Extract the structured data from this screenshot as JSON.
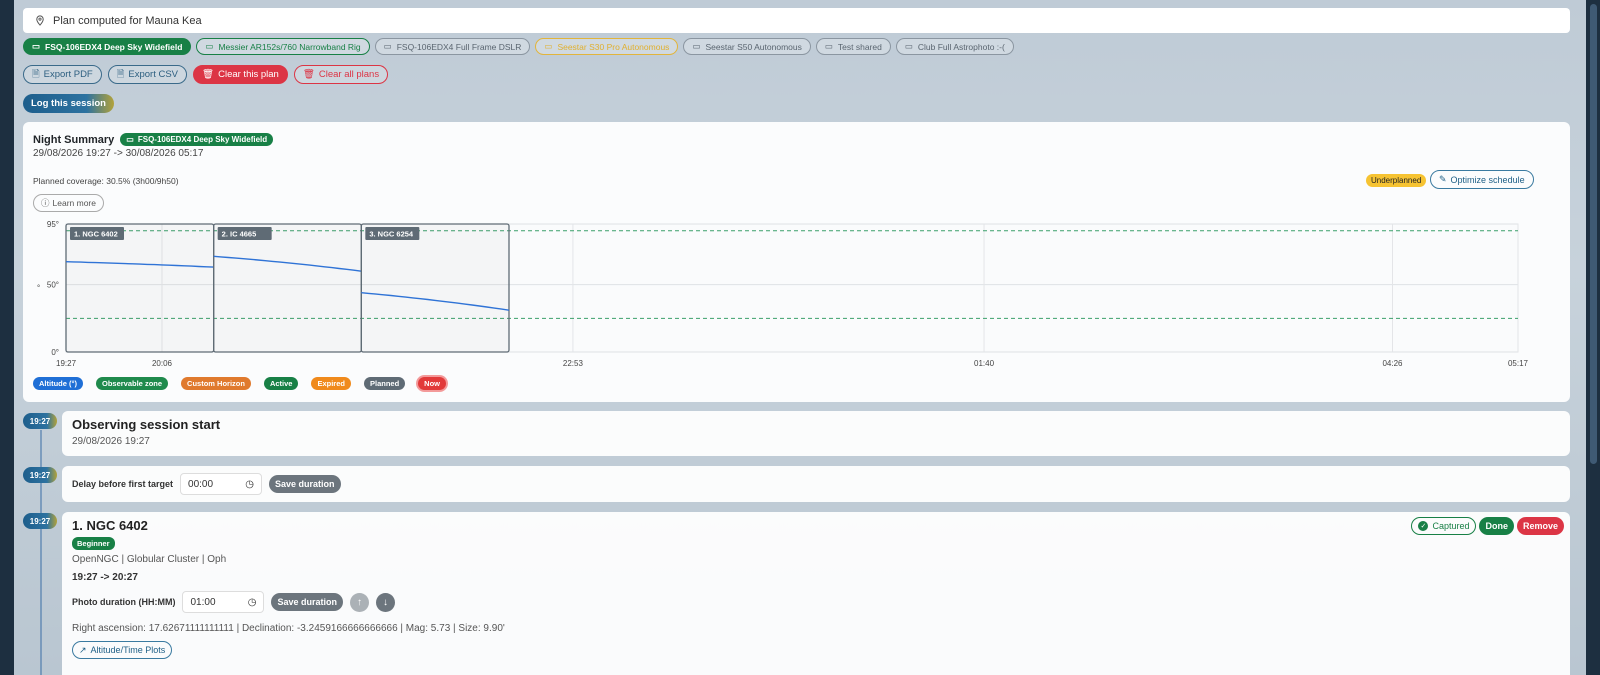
{
  "location": {
    "text": "Plan computed for Mauna Kea",
    "icon": "map-pin-icon"
  },
  "rigs": [
    {
      "label": "FSQ-106EDX4 Deep Sky Widefield",
      "state": "active"
    },
    {
      "label": "Messier AR152s/760 Narrowband Rig",
      "state": "green"
    },
    {
      "label": "FSQ-106EDX4 Full Frame DSLR",
      "state": "normal"
    },
    {
      "label": "Seestar S30 Pro Autonomous",
      "state": "yellow"
    },
    {
      "label": "Seestar S50 Autonomous",
      "state": "normal"
    },
    {
      "label": "Test shared",
      "state": "normal"
    },
    {
      "label": "Club Full Astrophoto :-(",
      "state": "normal"
    }
  ],
  "actions": {
    "export_pdf": "Export PDF",
    "export_csv": "Export CSV",
    "clear_plan": "Clear this plan",
    "clear_all": "Clear all plans",
    "log_session": "Log this session"
  },
  "summary": {
    "title": "Night Summary",
    "rig": "FSQ-106EDX4 Deep Sky Widefield",
    "dates": "29/08/2026 19:27 -> 30/08/2026 05:17",
    "coverage": "Planned coverage: 30.5% (3h00/9h50)",
    "learn_more": "Learn more",
    "status": "Underplanned",
    "optimize": "Optimize schedule"
  },
  "chart_data": {
    "type": "line",
    "ylim": [
      0,
      95
    ],
    "y_ticks": [
      "95°",
      "50°",
      "0°"
    ],
    "ylabel": "°",
    "x_range_hours": [
      0,
      9.833
    ],
    "x_ticks": [
      {
        "label": "19:27",
        "t": 0
      },
      {
        "label": "20:06",
        "t": 0.65
      },
      {
        "label": "22:53",
        "t": 3.433
      },
      {
        "label": "01:40",
        "t": 6.217
      },
      {
        "label": "04:26",
        "t": 8.983
      },
      {
        "label": "05:17",
        "t": 9.833
      }
    ],
    "observable_zone": [
      25,
      90
    ],
    "targets": [
      {
        "label": "1. NGC 6402",
        "start": 0,
        "end": 1,
        "alt": [
          67,
          63
        ]
      },
      {
        "label": "2. IC 4665",
        "start": 1,
        "end": 2,
        "alt": [
          71,
          60
        ]
      },
      {
        "label": "3. NGC 6254",
        "start": 2,
        "end": 3,
        "alt": [
          44,
          31
        ]
      }
    ],
    "legend": [
      {
        "label": "Altitude (°)",
        "color": "#1f6fd6"
      },
      {
        "label": "Observable zone",
        "color": "#1f8a4c"
      },
      {
        "label": "Custom Horizon",
        "color": "#e07a2e"
      },
      {
        "label": "Active",
        "color": "#188046"
      },
      {
        "label": "Expired",
        "color": "#f08a1c"
      },
      {
        "label": "Planned",
        "color": "#5f6b75"
      },
      {
        "label": "Now",
        "color": "#e23a3a"
      }
    ]
  },
  "session_start": {
    "time": "19:27",
    "title": "Observing session start",
    "date": "29/08/2026 19:27"
  },
  "delay": {
    "time": "19:27",
    "label": "Delay before first target",
    "value": "00:00",
    "save": "Save duration"
  },
  "target1": {
    "time": "19:27",
    "title": "1. NGC 6402",
    "level": "Beginner",
    "catalog": "OpenNGC | Globular Cluster | Oph",
    "window": "19:27 -> 20:27",
    "photo_label": "Photo duration (HH:MM)",
    "photo_value": "01:00",
    "save": "Save duration",
    "coords": "Right ascension: 17.62671111111111 | Declination: -3.2459166666666666 | Mag: 5.73 | Size: 9.90'",
    "plots": "Altitude/Time Plots",
    "captured": "Captured",
    "done": "Done",
    "remove": "Remove"
  }
}
